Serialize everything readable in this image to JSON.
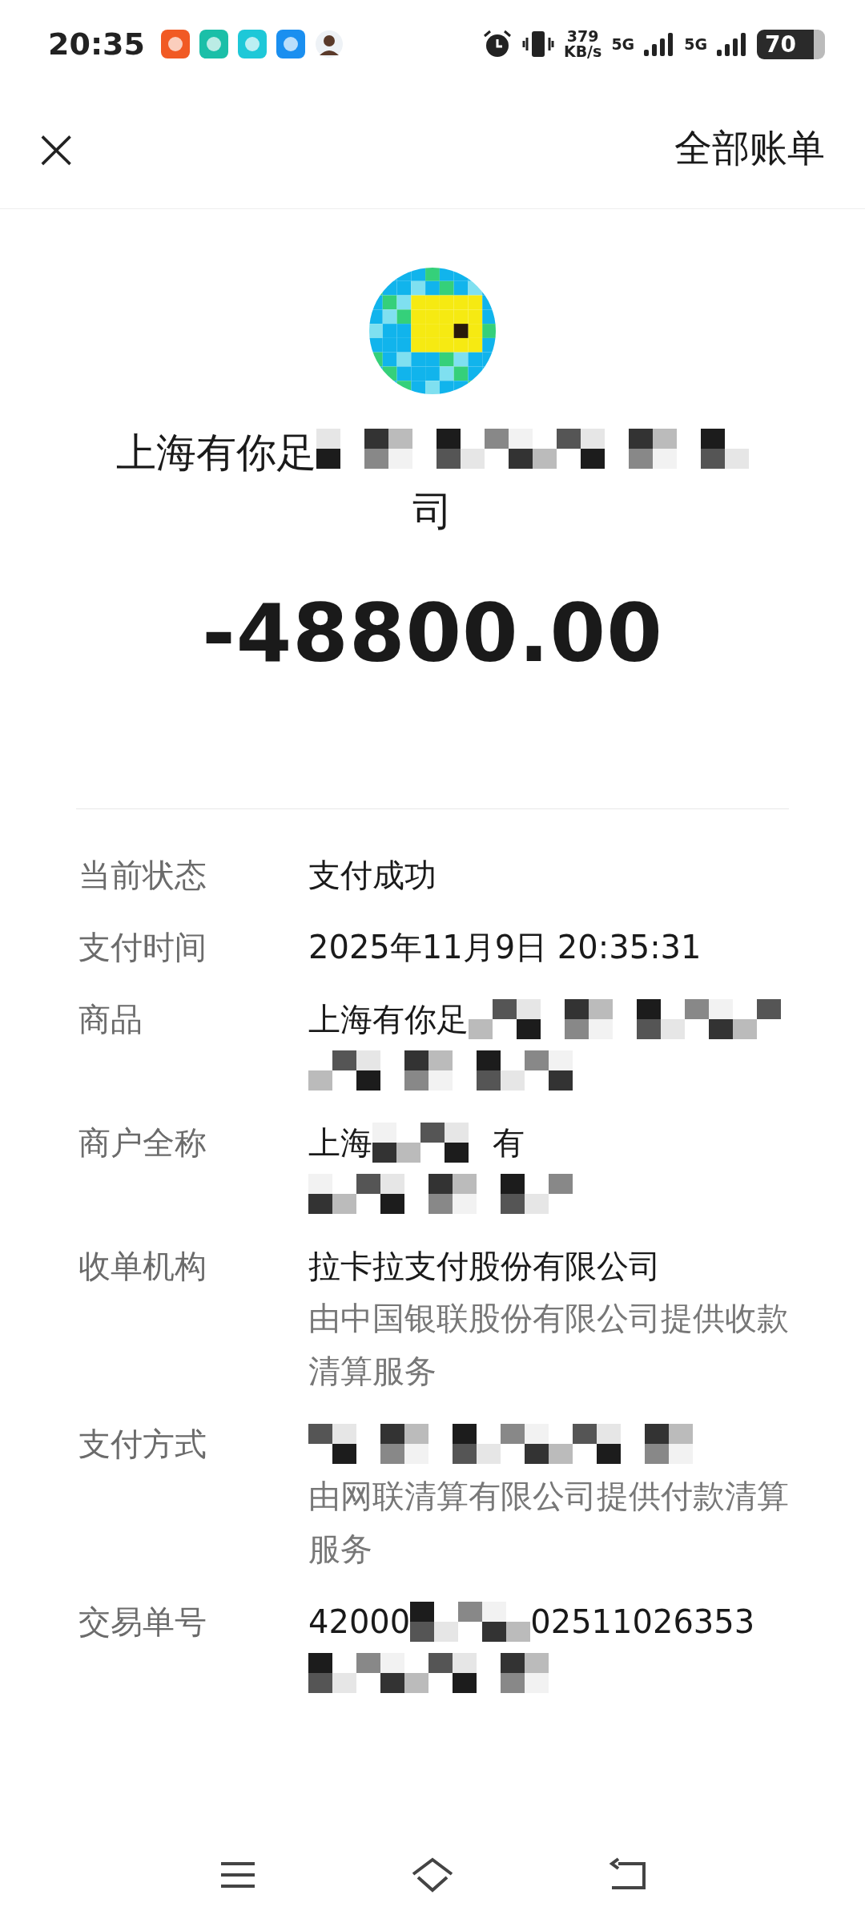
{
  "status_bar": {
    "time": "20:35",
    "net_speed": "379",
    "net_unit": "KB/s",
    "sim_1": "5G",
    "sim_2": "5G",
    "battery": "70"
  },
  "header": {
    "close": "×",
    "link": "全部账单"
  },
  "merchant": {
    "name_start": "上海有你足",
    "name_end": "司"
  },
  "amount": "-48800.00",
  "rows": [
    {
      "label": "当前状态",
      "lines": [
        [
          {
            "kind": "text",
            "text": "支付成功"
          }
        ]
      ]
    },
    {
      "label": "支付时间",
      "lines": [
        [
          {
            "kind": "text",
            "text": "2025年11月9日 20:35:31"
          }
        ]
      ]
    },
    {
      "label": "商品",
      "lines": [
        [
          {
            "kind": "text",
            "text": "上海有你足"
          },
          {
            "kind": "mosaic"
          }
        ],
        [
          {
            "kind": "mosaic"
          }
        ]
      ]
    },
    {
      "label": "商户全称",
      "lines": [
        [
          {
            "kind": "text",
            "text": "上海"
          },
          {
            "kind": "mosaic"
          },
          {
            "kind": "text",
            "text": "有"
          }
        ],
        [
          {
            "kind": "mosaic"
          }
        ]
      ]
    },
    {
      "label": "收单机构",
      "lines": [
        [
          {
            "kind": "text",
            "text": "拉卡拉支付股份有限公司"
          }
        ]
      ],
      "note": "由中国银联股份有限公司提供收款清算服务"
    },
    {
      "label": "支付方式",
      "lines": [
        [
          {
            "kind": "mosaic"
          }
        ]
      ],
      "note": "由网联清算有限公司提供付款清算服务"
    },
    {
      "label": "交易单号",
      "lines": [
        [
          {
            "kind": "text",
            "text": "42000"
          },
          {
            "kind": "mosaic"
          },
          {
            "kind": "text",
            "text": "02511026353"
          }
        ],
        [
          {
            "kind": "mosaic"
          }
        ]
      ]
    }
  ]
}
